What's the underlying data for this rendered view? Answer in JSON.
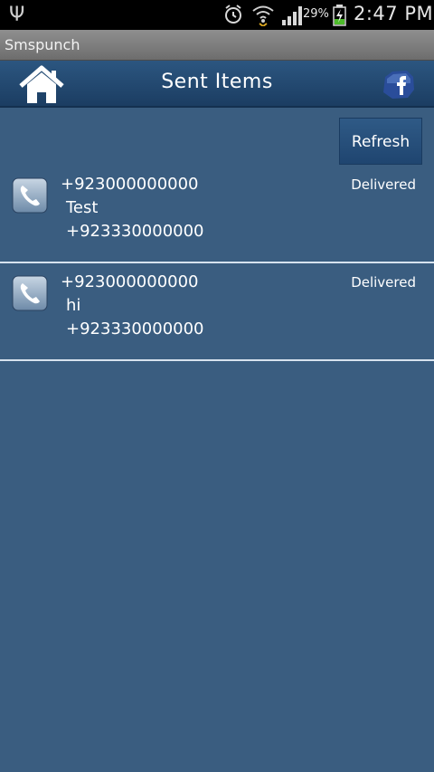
{
  "status_bar": {
    "battery_percent": "29%",
    "time": "2:47 PM",
    "icons": [
      "usb-icon",
      "alarm-icon",
      "wifi-icon",
      "signal-icon",
      "battery-charging-icon"
    ]
  },
  "app": {
    "title": "Smspunch"
  },
  "header": {
    "title": "Sent Items",
    "home_icon": "home-icon",
    "facebook_icon": "facebook-icon"
  },
  "refresh": {
    "label": "Refresh"
  },
  "messages": [
    {
      "sender": "+923000000000",
      "text": "Test",
      "recipient": "+923330000000",
      "status": "Delivered"
    },
    {
      "sender": "+923000000000",
      "text": "hi",
      "recipient": "+923330000000",
      "status": "Delivered"
    }
  ],
  "colors": {
    "background": "#3a5d80",
    "header": "#1b3d62",
    "divider": "#d6e2ee"
  }
}
